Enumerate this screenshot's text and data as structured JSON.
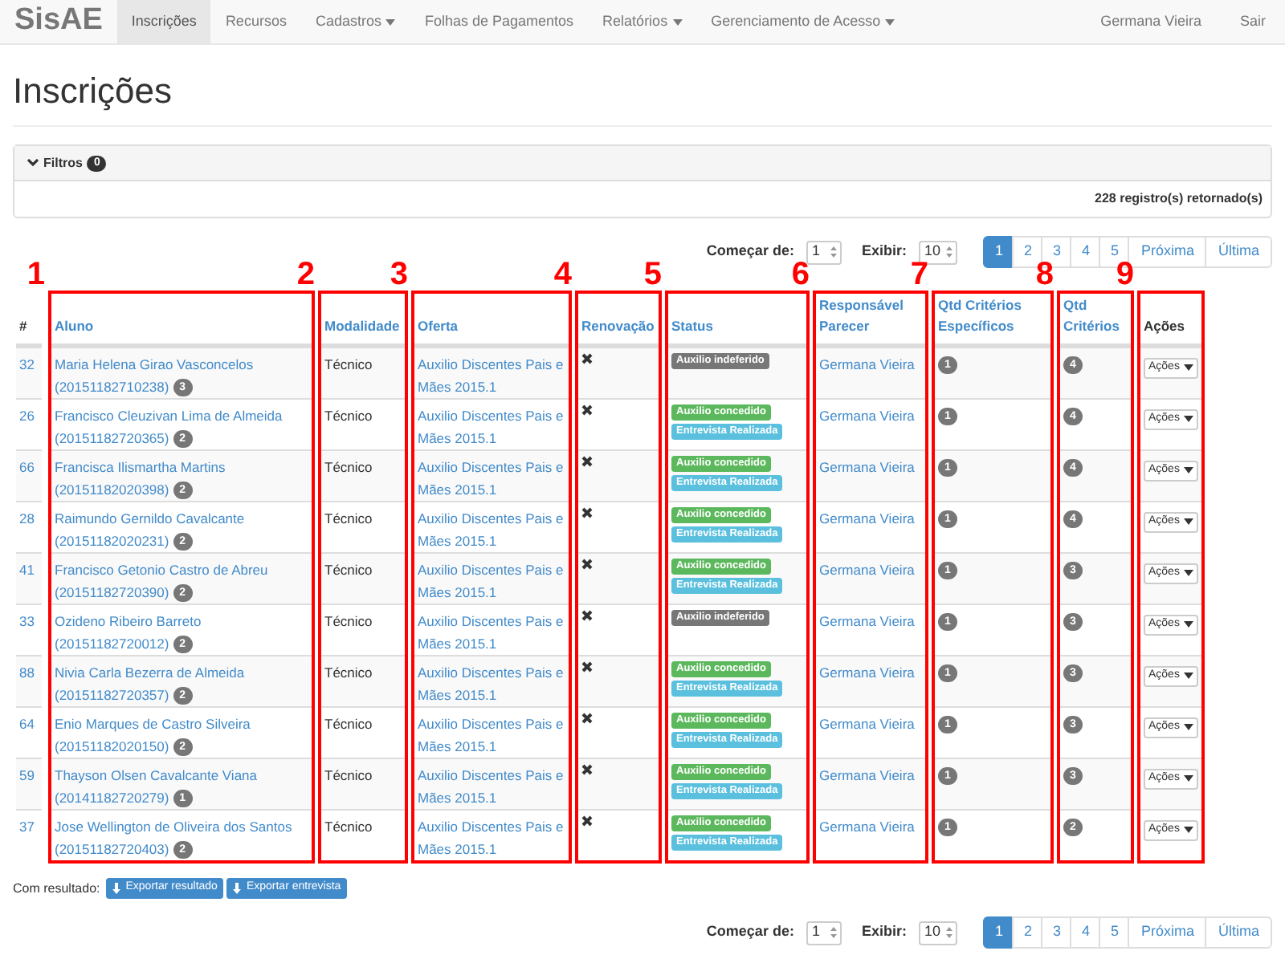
{
  "navbar": {
    "brand": "SisAE",
    "items": [
      {
        "label": "Inscrições",
        "selected": true,
        "dropdown": false
      },
      {
        "label": "Recursos",
        "selected": false,
        "dropdown": false
      },
      {
        "label": "Cadastros",
        "selected": false,
        "dropdown": true
      },
      {
        "label": "Folhas de Pagamentos",
        "selected": false,
        "dropdown": false
      },
      {
        "label": "Relatórios",
        "selected": false,
        "dropdown": true
      },
      {
        "label": "Gerenciamento de Acesso",
        "selected": false,
        "dropdown": true
      }
    ],
    "right_items": [
      "Germana Vieira",
      "Sair"
    ]
  },
  "page_title": "Inscrições",
  "filters": {
    "label": "Filtros",
    "count": "0",
    "expanded": true,
    "records": "228 registro(s) retornado(s)"
  },
  "paginations": [
    {
      "start_label": "Começar de:",
      "start_value": "1",
      "show_label": "Exibir:",
      "show_value": "10",
      "pages": [
        {
          "label": "1",
          "selected": true
        },
        {
          "label": "2",
          "selected": false
        },
        {
          "label": "3",
          "selected": false
        },
        {
          "label": "4",
          "selected": false
        },
        {
          "label": "5",
          "selected": false
        }
      ],
      "next": "Próxima",
      "last": "Última"
    },
    {
      "start_label": "Começar de:",
      "start_value": "1",
      "show_label": "Exibir:",
      "show_value": "10",
      "pages": [
        {
          "label": "1",
          "selected": true
        },
        {
          "label": "2",
          "selected": false
        },
        {
          "label": "3",
          "selected": false
        },
        {
          "label": "4",
          "selected": false
        },
        {
          "label": "5",
          "selected": false
        }
      ],
      "next": "Próxima",
      "last": "Última"
    }
  ],
  "table": {
    "columns": [
      {
        "label": "#",
        "kind": "id",
        "sortable": false,
        "annotation": "1",
        "boxed": false
      },
      {
        "label": "Aluno",
        "kind": "aluno",
        "sortable": true,
        "annotation": "2",
        "boxed": true
      },
      {
        "label": "Modalidade",
        "kind": "modalidade",
        "sortable": true,
        "annotation": "3",
        "boxed": true
      },
      {
        "label": "Oferta",
        "kind": "oferta",
        "sortable": true,
        "annotation": "4",
        "boxed": true
      },
      {
        "label": "Renovação",
        "kind": "renovacao",
        "sortable": true,
        "annotation": "5",
        "boxed": true
      },
      {
        "label": "Status",
        "kind": "status",
        "sortable": true,
        "annotation": "6",
        "boxed": true
      },
      {
        "label": "Responsável Parecer",
        "kind": "responsavel",
        "sortable": true,
        "annotation": "7",
        "boxed": true
      },
      {
        "label": "Qtd Critérios Específicos",
        "kind": "qtd_especificos",
        "sortable": true,
        "annotation": "8",
        "boxed": true
      },
      {
        "label": "Qtd Critérios",
        "kind": "qtd_criterios",
        "sortable": true,
        "annotation": "9",
        "boxed": true
      },
      {
        "label": "Ações",
        "kind": "acoes",
        "sortable": false,
        "boxed": true
      }
    ],
    "rows": [
      {
        "id": "32",
        "aluno": "Maria Helena Girao Vasconcelos (20151182710238)",
        "badge": "3",
        "modalidade": "Técnico",
        "oferta": "Auxilio Discentes Pais e Mães 2015.1",
        "renovacao": false,
        "status": [
          {
            "label": "Auxilio indeferido",
            "kind": "default"
          }
        ],
        "responsavel": "Germana Vieira",
        "qtd_especificos": "1",
        "qtd_criterios": "4",
        "acoes": "Ações"
      },
      {
        "id": "26",
        "aluno": "Francisco Cleuzivan Lima de Almeida (20151182720365)",
        "badge": "2",
        "modalidade": "Técnico",
        "oferta": "Auxilio Discentes Pais e Mães 2015.1",
        "renovacao": false,
        "status": [
          {
            "label": "Auxilio concedido",
            "kind": "success"
          },
          {
            "label": "Entrevista Realizada",
            "kind": "info"
          }
        ],
        "responsavel": "Germana Vieira",
        "qtd_especificos": "1",
        "qtd_criterios": "4",
        "acoes": "Ações"
      },
      {
        "id": "66",
        "aluno": "Francisca Ilismartha Martins (20151182020398)",
        "badge": "2",
        "modalidade": "Técnico",
        "oferta": "Auxilio Discentes Pais e Mães 2015.1",
        "renovacao": false,
        "status": [
          {
            "label": "Auxilio concedido",
            "kind": "success"
          },
          {
            "label": "Entrevista Realizada",
            "kind": "info"
          }
        ],
        "responsavel": "Germana Vieira",
        "qtd_especificos": "1",
        "qtd_criterios": "4",
        "acoes": "Ações"
      },
      {
        "id": "28",
        "aluno": "Raimundo Gernildo Cavalcante (20151182020231)",
        "badge": "2",
        "modalidade": "Técnico",
        "oferta": "Auxilio Discentes Pais e Mães 2015.1",
        "renovacao": false,
        "status": [
          {
            "label": "Auxilio concedido",
            "kind": "success"
          },
          {
            "label": "Entrevista Realizada",
            "kind": "info"
          }
        ],
        "responsavel": "Germana Vieira",
        "qtd_especificos": "1",
        "qtd_criterios": "4",
        "acoes": "Ações"
      },
      {
        "id": "41",
        "aluno": "Francisco Getonio Castro de Abreu (20151182720390)",
        "badge": "2",
        "modalidade": "Técnico",
        "oferta": "Auxilio Discentes Pais e Mães 2015.1",
        "renovacao": false,
        "status": [
          {
            "label": "Auxilio concedido",
            "kind": "success"
          },
          {
            "label": "Entrevista Realizada",
            "kind": "info"
          }
        ],
        "responsavel": "Germana Vieira",
        "qtd_especificos": "1",
        "qtd_criterios": "3",
        "acoes": "Ações"
      },
      {
        "id": "33",
        "aluno": "Ozideno Ribeiro Barreto (20151182720012)",
        "badge": "2",
        "modalidade": "Técnico",
        "oferta": "Auxilio Discentes Pais e Mães 2015.1",
        "renovacao": false,
        "status": [
          {
            "label": "Auxilio indeferido",
            "kind": "default"
          }
        ],
        "responsavel": "Germana Vieira",
        "qtd_especificos": "1",
        "qtd_criterios": "3",
        "acoes": "Ações"
      },
      {
        "id": "88",
        "aluno": "Nivia Carla Bezerra de Almeida (20151182720357)",
        "badge": "2",
        "modalidade": "Técnico",
        "oferta": "Auxilio Discentes Pais e Mães 2015.1",
        "renovacao": false,
        "status": [
          {
            "label": "Auxilio concedido",
            "kind": "success"
          },
          {
            "label": "Entrevista Realizada",
            "kind": "info"
          }
        ],
        "responsavel": "Germana Vieira",
        "qtd_especificos": "1",
        "qtd_criterios": "3",
        "acoes": "Ações"
      },
      {
        "id": "64",
        "aluno": "Enio Marques de Castro Silveira (20151182020150)",
        "badge": "2",
        "modalidade": "Técnico",
        "oferta": "Auxilio Discentes Pais e Mães 2015.1",
        "renovacao": false,
        "status": [
          {
            "label": "Auxilio concedido",
            "kind": "success"
          },
          {
            "label": "Entrevista Realizada",
            "kind": "info"
          }
        ],
        "responsavel": "Germana Vieira",
        "qtd_especificos": "1",
        "qtd_criterios": "3",
        "acoes": "Ações"
      },
      {
        "id": "59",
        "aluno": "Thayson Olsen Cavalcante Viana (20141182720279)",
        "badge": "1",
        "modalidade": "Técnico",
        "oferta": "Auxilio Discentes Pais e Mães 2015.1",
        "renovacao": false,
        "status": [
          {
            "label": "Auxilio concedido",
            "kind": "success"
          },
          {
            "label": "Entrevista Realizada",
            "kind": "info"
          }
        ],
        "responsavel": "Germana Vieira",
        "qtd_especificos": "1",
        "qtd_criterios": "3",
        "acoes": "Ações"
      },
      {
        "id": "37",
        "aluno": "Jose Wellington de Oliveira dos Santos (20151182720403)",
        "badge": "2",
        "modalidade": "Técnico",
        "oferta": "Auxilio Discentes Pais e Mães 2015.1",
        "renovacao": false,
        "status": [
          {
            "label": "Auxilio concedido",
            "kind": "success"
          },
          {
            "label": "Entrevista Realizada",
            "kind": "info"
          }
        ],
        "responsavel": "Germana Vieira",
        "qtd_especificos": "1",
        "qtd_criterios": "2",
        "acoes": "Ações"
      }
    ]
  },
  "export": {
    "label": "Com resultado:",
    "buttons": [
      "Exportar resultado",
      "Exportar entrevista"
    ]
  }
}
